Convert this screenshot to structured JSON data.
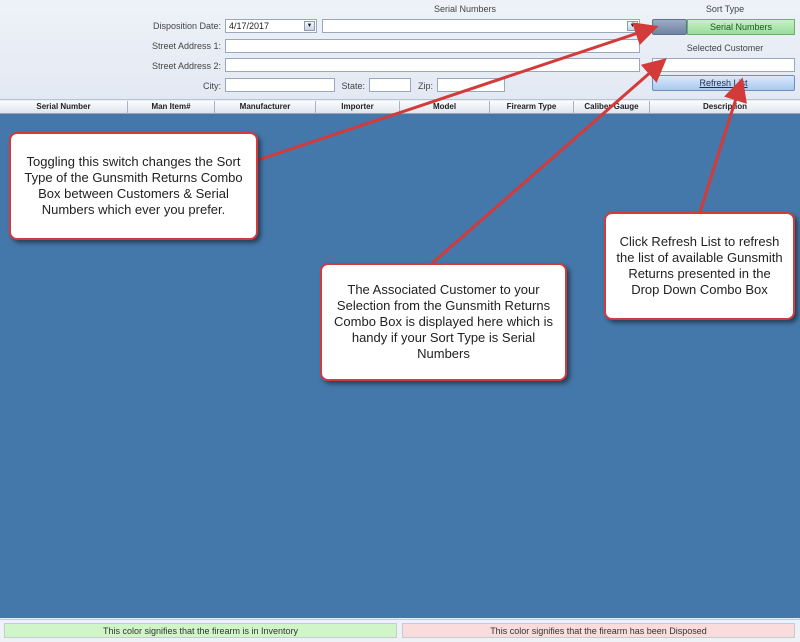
{
  "header": {
    "serial_numbers_title": "Serial Numbers",
    "sort_type_title": "Sort Type",
    "selected_customer_title": "Selected Customer"
  },
  "form": {
    "disposition_date_label": "Disposition Date:",
    "disposition_date_value": "4/17/2017",
    "street1_label": "Street Address 1:",
    "street2_label": "Street Address 2:",
    "city_label": "City:",
    "state_label": "State:",
    "zip_label": "Zip:"
  },
  "sort_toggle": {
    "label": "Serial Numbers",
    "active_color": "#99dc9b"
  },
  "refresh_button": {
    "label": "Refresh List"
  },
  "grid": {
    "columns": [
      "Serial Number",
      "Man Item#",
      "Manufacturer",
      "Importer",
      "Model",
      "Firearm Type",
      "Caliber Gauge",
      "Description"
    ],
    "background_color": "#4477aa"
  },
  "legend": {
    "inventory": "This color signifies that the firearm is in Inventory",
    "inventory_color": "#cff5c9",
    "disposed": "This color signifies that the firearm has been Disposed",
    "disposed_color": "#fbdcdc"
  },
  "callouts": {
    "toggle": "Toggling this switch changes the Sort Type of the Gunsmith Returns Combo Box between Customers & Serial Numbers which ever you prefer.",
    "customer": "The Associated Customer to your Selection from the Gunsmith Returns Combo Box is displayed here which is handy if your Sort Type is Serial Numbers",
    "refresh": "Click Refresh List to refresh the list of available Gunsmith Returns presented in the Drop Down Combo Box",
    "border_color": "#d33a3a"
  }
}
